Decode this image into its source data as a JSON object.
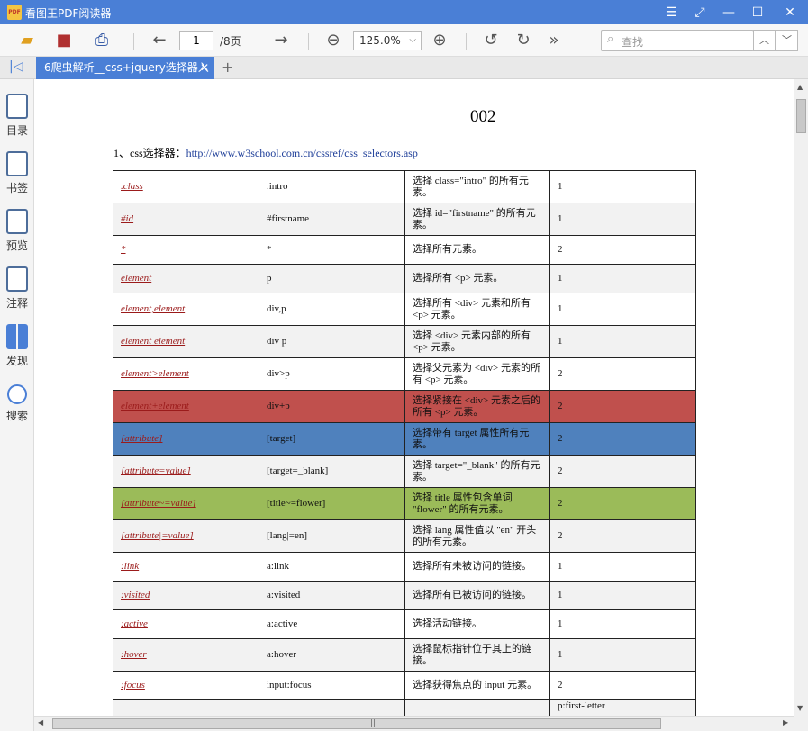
{
  "app": {
    "title": "看图王PDF阅读器",
    "logo_text": "PDF"
  },
  "toolbar": {
    "page_current": "1",
    "page_total": "/8页",
    "zoom": "125.0%",
    "search_placeholder": "查找",
    "more_symbol": "»"
  },
  "tabs": [
    {
      "label": "6爬虫解析__css+jquery选择器入"
    }
  ],
  "sidebar": {
    "items": [
      {
        "label": "目录",
        "icon": "toc-icon"
      },
      {
        "label": "书签",
        "icon": "bookmark-icon"
      },
      {
        "label": "预览",
        "icon": "thumbnail-icon"
      },
      {
        "label": "注释",
        "icon": "annotation-icon"
      },
      {
        "label": "发现",
        "icon": "discover-icon"
      },
      {
        "label": "搜索",
        "icon": "search-icon"
      }
    ]
  },
  "document": {
    "page_number": "002",
    "heading_prefix": "1、css选择器：",
    "heading_link": "http://www.w3school.com.cn/cssref/css_selectors.asp",
    "rows": [
      {
        "selector": ".class",
        "example": ".intro",
        "desc": "选择 class=\"intro\" 的所有元素。",
        "version": "1",
        "bg": ""
      },
      {
        "selector": "#id",
        "example": "#firstname",
        "desc": "选择 id=\"firstname\" 的所有元素。",
        "version": "1",
        "bg": ""
      },
      {
        "selector": "*",
        "example": "*",
        "desc": "选择所有元素。",
        "version": "2",
        "bg": ""
      },
      {
        "selector": "element",
        "example": "p",
        "desc": "选择所有 <p> 元素。",
        "version": "1",
        "bg": ""
      },
      {
        "selector": "element,element",
        "example": "div,p",
        "desc": "选择所有 <div> 元素和所有 <p> 元素。",
        "version": "1",
        "bg": ""
      },
      {
        "selector": "element element",
        "example": "div p",
        "desc": "选择 <div> 元素内部的所有 <p> 元素。",
        "version": "1",
        "bg": ""
      },
      {
        "selector": "element>element",
        "example": "div>p",
        "desc": "选择父元素为 <div> 元素的所有 <p> 元素。",
        "version": "2",
        "bg": ""
      },
      {
        "selector": "element+element",
        "example": "div+p",
        "desc": "选择紧接在 <div> 元素之后的所有 <p> 元素。",
        "version": "2",
        "bg": "#c0504d"
      },
      {
        "selector": "[attribute]",
        "example": "[target]",
        "desc": "选择带有 target 属性所有元素。",
        "version": "2",
        "bg": "#4f81bd"
      },
      {
        "selector": "[attribute=value]",
        "example": "[target=_blank]",
        "desc": "选择 target=\"_blank\" 的所有元素。",
        "version": "2",
        "bg": ""
      },
      {
        "selector": "[attribute~=value]",
        "example": "[title~=flower]",
        "desc": "选择 title 属性包含单词 \"flower\" 的所有元素。",
        "version": "2",
        "bg": "#9bbb59"
      },
      {
        "selector": "[attribute|=value]",
        "example": "[lang|=en]",
        "desc": "选择 lang 属性值以 \"en\" 开头的所有元素。",
        "version": "2",
        "bg": ""
      },
      {
        "selector": ":link",
        "example": "a:link",
        "desc": "选择所有未被访问的链接。",
        "version": "1",
        "bg": ""
      },
      {
        "selector": ":visited",
        "example": "a:visited",
        "desc": "选择所有已被访问的链接。",
        "version": "1",
        "bg": ""
      },
      {
        "selector": ":active",
        "example": "a:active",
        "desc": "选择活动链接。",
        "version": "1",
        "bg": ""
      },
      {
        "selector": ":hover",
        "example": "a:hover",
        "desc": "选择鼠标指针位于其上的链接。",
        "version": "1",
        "bg": ""
      },
      {
        "selector": ":focus",
        "example": "input:focus",
        "desc": "选择获得焦点的 input 元素。",
        "version": "2",
        "bg": ""
      },
      {
        "selector": "",
        "example": "",
        "desc": "",
        "version": "p:first-letter",
        "bg": ""
      }
    ]
  },
  "colors": {
    "accent": "#4a7fd6",
    "selector_text": "#9b1b1b",
    "link": "#1f3f99"
  }
}
